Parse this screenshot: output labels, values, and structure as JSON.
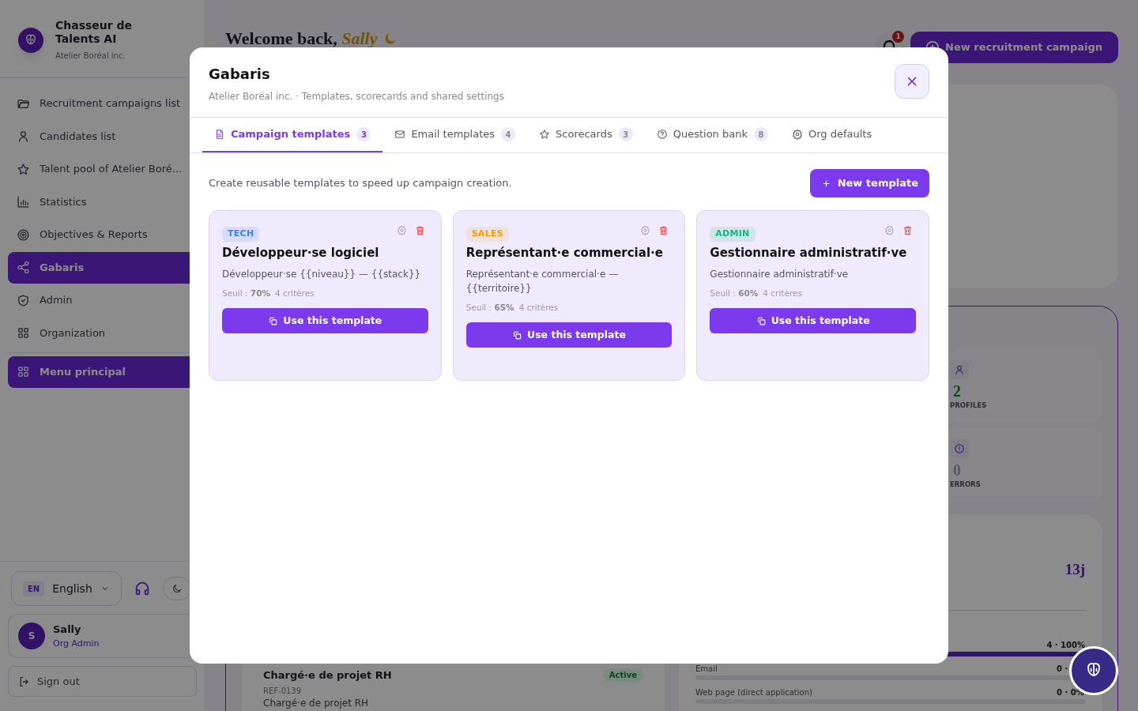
{
  "sidebar": {
    "brand": {
      "name": "Chasseur de Talents AI",
      "org": "Atelier Boréal inc."
    },
    "items": [
      {
        "label": "Recruitment campaigns list",
        "selected": false
      },
      {
        "label": "Candidates list",
        "selected": false
      },
      {
        "label": "Talent pool of Atelier Boré...",
        "selected": false
      },
      {
        "label": "Statistics",
        "selected": false
      },
      {
        "label": "Objectives & Reports",
        "selected": false
      },
      {
        "label": "Gabaris",
        "selected": true
      },
      {
        "label": "Admin",
        "selected": false
      },
      {
        "label": "Organization",
        "selected": false
      }
    ],
    "menu_button": "Menu principal",
    "language": {
      "code": "EN",
      "label": "English"
    },
    "user": {
      "initial": "S",
      "name": "Sally",
      "role": "Org Admin"
    },
    "sign_out": "Sign out"
  },
  "header": {
    "greeting": "Welcome back,",
    "name": "Sally",
    "notifications": "1",
    "new_campaign": "New recruitment campaign"
  },
  "stats": [
    {
      "value": "2",
      "label": "PROFILES"
    },
    {
      "value": "0",
      "label": "ERRORS"
    }
  ],
  "sources": {
    "delay": "13j",
    "channels": [
      {
        "reading": "4 · 100%",
        "level": 1
      },
      {
        "label": "Email",
        "reading": "0 ·"
      },
      {
        "label": "Web page (direct application)",
        "reading": "0 · 0%"
      }
    ]
  },
  "campaign": {
    "title": "Chargé·e de projet RH",
    "status": "Active",
    "ref": "REF-0139",
    "subtitle": "Chargé·e de projet RH"
  },
  "modal": {
    "title": "Gabaris",
    "subtitle": "Atelier Boréal inc. · Templates, scorecards and shared settings",
    "tabs": [
      {
        "label": "Campaign templates",
        "count": "3",
        "selected": true
      },
      {
        "label": "Email templates",
        "count": "4",
        "selected": false
      },
      {
        "label": "Scorecards",
        "count": "3",
        "selected": false
      },
      {
        "label": "Question bank",
        "count": "8",
        "selected": false
      },
      {
        "label": "Org defaults",
        "selected": false
      }
    ],
    "intro": "Create reusable templates to speed up campaign creation.",
    "new_template": "New template",
    "templates": [
      {
        "category": "TECH",
        "color": "#3b82f6",
        "title": "Développeur·se logiciel",
        "description": "Développeur·se {{niveau}} — {{stack}}",
        "threshold": "Seuil : **70%**",
        "criteria": "4 critères",
        "action": "Use this template"
      },
      {
        "category": "SALES",
        "color": "#f59e0b",
        "title": "Représentant·e commercial·e",
        "description": "Représentant·e commercial·e — {{territoire}}",
        "threshold": "Seuil : **65%**",
        "criteria": "4 critères",
        "action": "Use this template"
      },
      {
        "category": "ADMIN",
        "color": "#10b981",
        "title": "Gestionnaire administratif·ve",
        "description": "Gestionnaire administratif·ve",
        "threshold": "Seuil : **60%**",
        "criteria": "4 critères",
        "action": "Use this template"
      }
    ]
  }
}
